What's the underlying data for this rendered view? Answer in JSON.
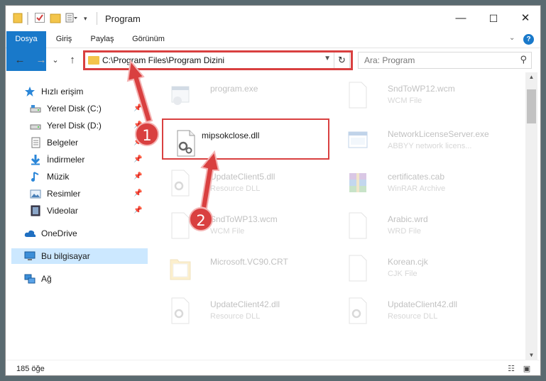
{
  "window": {
    "title": "Program",
    "minimize": "—",
    "maximize": "☐",
    "close": "✕"
  },
  "ribbon": {
    "tabs": [
      "Dosya",
      "Giriş",
      "Paylaş",
      "Görünüm"
    ],
    "collapse_icon": "chevron-down-icon",
    "help_icon": "help-icon"
  },
  "navigation": {
    "back": "←",
    "forward": "→",
    "history": "⌄",
    "up": "↑"
  },
  "address_bar": {
    "path": "C:\\Program Files\\Program Dizini",
    "refresh": "↻"
  },
  "search": {
    "placeholder": "Ara: Program"
  },
  "nav_pane": {
    "items": [
      {
        "label": "Hızlı erişim",
        "icon": "star-icon"
      },
      {
        "label": "Yerel Disk (C:)",
        "icon": "drive-icon",
        "pinned": true
      },
      {
        "label": "Yerel Disk (D:)",
        "icon": "drive-icon",
        "pinned": true
      },
      {
        "label": "Belgeler",
        "icon": "documents-icon",
        "pinned": true
      },
      {
        "label": "İndirmeler",
        "icon": "download-icon",
        "pinned": true
      },
      {
        "label": "Müzik",
        "icon": "music-icon",
        "pinned": true
      },
      {
        "label": "Resimler",
        "icon": "pictures-icon",
        "pinned": true
      },
      {
        "label": "Videolar",
        "icon": "videos-icon",
        "pinned": true
      },
      {
        "label": "OneDrive",
        "icon": "cloud-icon"
      },
      {
        "label": "Bu bilgisayar",
        "icon": "computer-icon",
        "selected": true
      },
      {
        "label": "Ağ",
        "icon": "network-icon"
      }
    ]
  },
  "files": [
    {
      "name": "program.exe",
      "type": ""
    },
    {
      "name": "SndToWP12.wcm",
      "type": "WCM File"
    },
    {
      "name": "mipsokclose.dll",
      "type": ""
    },
    {
      "name": "NetworkLicenseServer.exe",
      "type": "ABBYY network licens..."
    },
    {
      "name": "UpdateClient5.dll",
      "type": "Resource DLL"
    },
    {
      "name": "certificates.cab",
      "type": "WinRAR Archive"
    },
    {
      "name": "SndToWP13.wcm",
      "type": "WCM File"
    },
    {
      "name": "Arabic.wrd",
      "type": "WRD File"
    },
    {
      "name": "Microsoft.VC90.CRT",
      "type": ""
    },
    {
      "name": "Korean.cjk",
      "type": "CJK File"
    },
    {
      "name": "UpdateClient42.dll",
      "type": "Resource DLL"
    },
    {
      "name": "UpdateClient42.dll",
      "type": "Resource DLL"
    }
  ],
  "status": {
    "item_count": "185 öğe"
  },
  "annotations": {
    "step1": "1",
    "step2": "2",
    "highlight_color": "#d94040"
  }
}
